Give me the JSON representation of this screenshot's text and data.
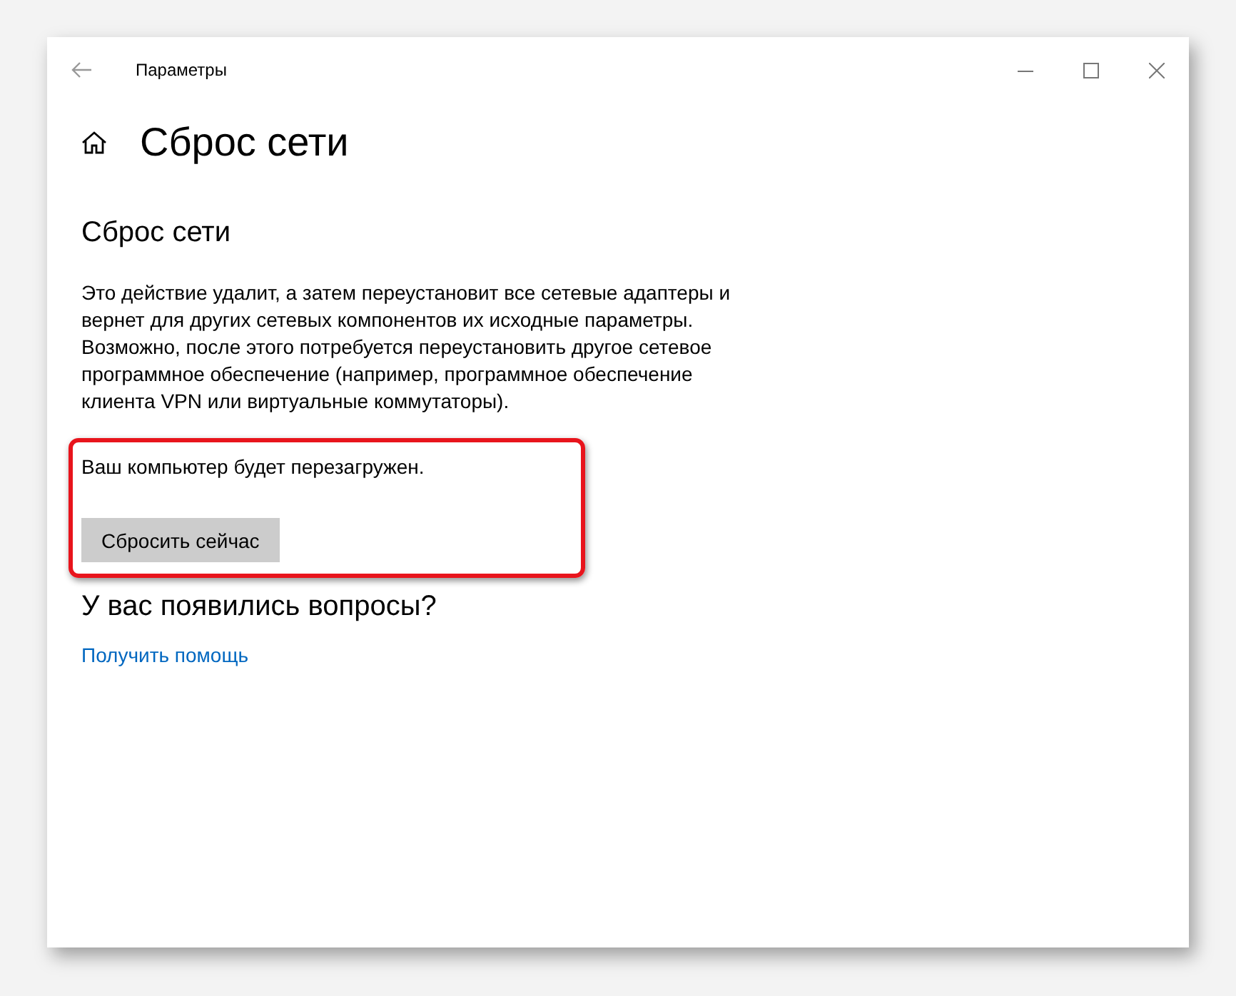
{
  "window": {
    "title": "Параметры"
  },
  "page_title": "Сброс сети",
  "section": {
    "heading": "Сброс сети",
    "description": "Это действие удалит, а затем переустановит все сетевые адаптеры и вернет для других сетевых компонентов их исходные параметры. Возможно, после этого потребуется переустановить другое сетевое программное обеспечение (например, программное обеспечение клиента VPN или виртуальные коммутаторы).",
    "warning": "Ваш компьютер будет перезагружен.",
    "button": "Сбросить сейчас",
    "highlighted": true
  },
  "help": {
    "heading": "У вас появились вопросы?",
    "link": "Получить помощь"
  }
}
